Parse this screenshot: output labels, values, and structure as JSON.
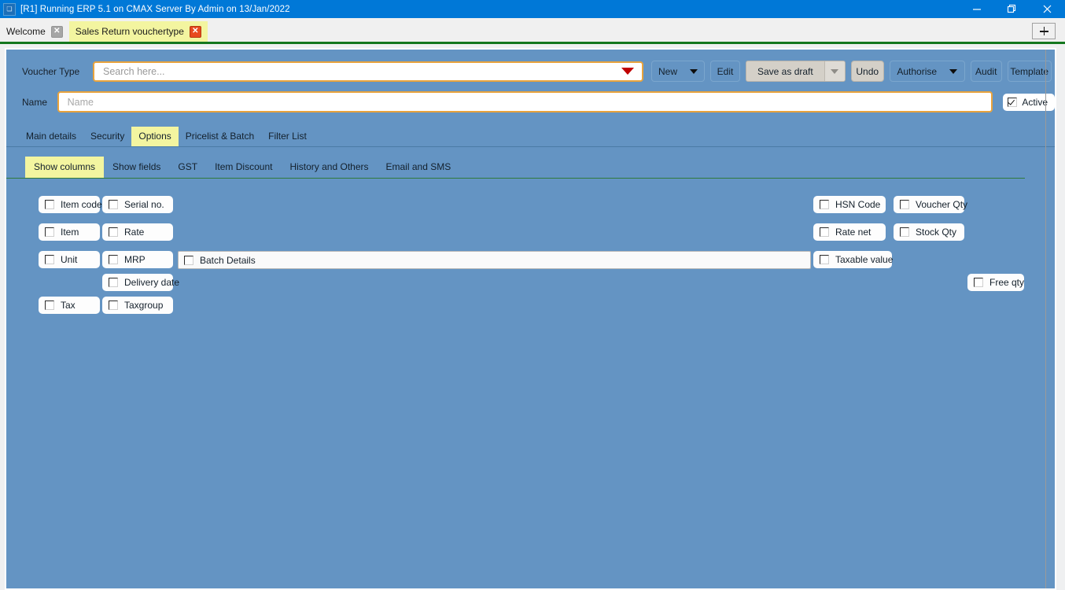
{
  "window": {
    "title": "[R1] Running ERP 5.1 on CMAX Server By Admin on 13/Jan/2022",
    "app_icon": "app-icon",
    "minimize_label": "minimize-icon",
    "restore_label": "restore-icon",
    "close_label": "close-icon",
    "titlebar_color": "#0078d7"
  },
  "tabstrip": {
    "tabs": [
      {
        "label": "Welcome",
        "active": false,
        "close_icon": "close-icon"
      },
      {
        "label": "Sales Return vouchertype",
        "active": true,
        "close_icon": "close-icon"
      }
    ],
    "add_tab_label": "+",
    "accent_color": "#14771f"
  },
  "form": {
    "voucher_type_label": "Voucher Type",
    "voucher_type_placeholder": "Search here...",
    "voucher_type_value": "",
    "dropdown_icon": "caret-down-icon",
    "name_label": "Name",
    "name_placeholder": "Name",
    "name_value": "",
    "active_label": "Active",
    "active_checked": true,
    "field_border_color": "#e8a33d"
  },
  "toolbar": {
    "new_label": "New",
    "edit_label": "Edit",
    "save_as_draft_label": "Save as draft",
    "undo_label": "Undo",
    "authorise_label": "Authorise",
    "audit_label": "Audit",
    "template_label": "Template"
  },
  "tabs_primary": [
    {
      "label": "Main details",
      "active": false
    },
    {
      "label": "Security",
      "active": false
    },
    {
      "label": "Options",
      "active": true
    },
    {
      "label": "Pricelist & Batch",
      "active": false
    },
    {
      "label": "Filter List",
      "active": false
    }
  ],
  "tabs_secondary": [
    {
      "label": "Show columns",
      "active": true
    },
    {
      "label": "Show fields",
      "active": false
    },
    {
      "label": "GST",
      "active": false
    },
    {
      "label": "Item Discount",
      "active": false
    },
    {
      "label": "History and Others",
      "active": false
    },
    {
      "label": "Email and SMS",
      "active": false
    }
  ],
  "show_columns": {
    "left_column": [
      {
        "label": "Item code",
        "checked": false
      },
      {
        "label": "Item",
        "checked": false
      },
      {
        "label": "Unit",
        "checked": false
      },
      {
        "label": "Tax",
        "checked": false
      }
    ],
    "second_column": [
      {
        "label": "Serial no.",
        "checked": false
      },
      {
        "label": "Rate",
        "checked": false
      },
      {
        "label": "MRP",
        "checked": false
      },
      {
        "label": "Delivery date",
        "checked": false
      },
      {
        "label": "Taxgroup",
        "checked": false
      }
    ],
    "batch_details": {
      "label": "Batch Details",
      "checked": false
    },
    "right_column_a": [
      {
        "label": "HSN  Code",
        "checked": false
      },
      {
        "label": "Rate net",
        "checked": false
      },
      {
        "label": "Taxable value",
        "checked": false
      }
    ],
    "right_column_b": [
      {
        "label": "Voucher Qty",
        "checked": false
      },
      {
        "label": "Stock Qty",
        "checked": false
      }
    ],
    "free_qty": {
      "label": "Free qty",
      "checked": false
    }
  },
  "theme": {
    "panel_blue": "#6494c3",
    "tab_yellow": "#f3f5a0",
    "page_gray": "#eff0f1"
  }
}
